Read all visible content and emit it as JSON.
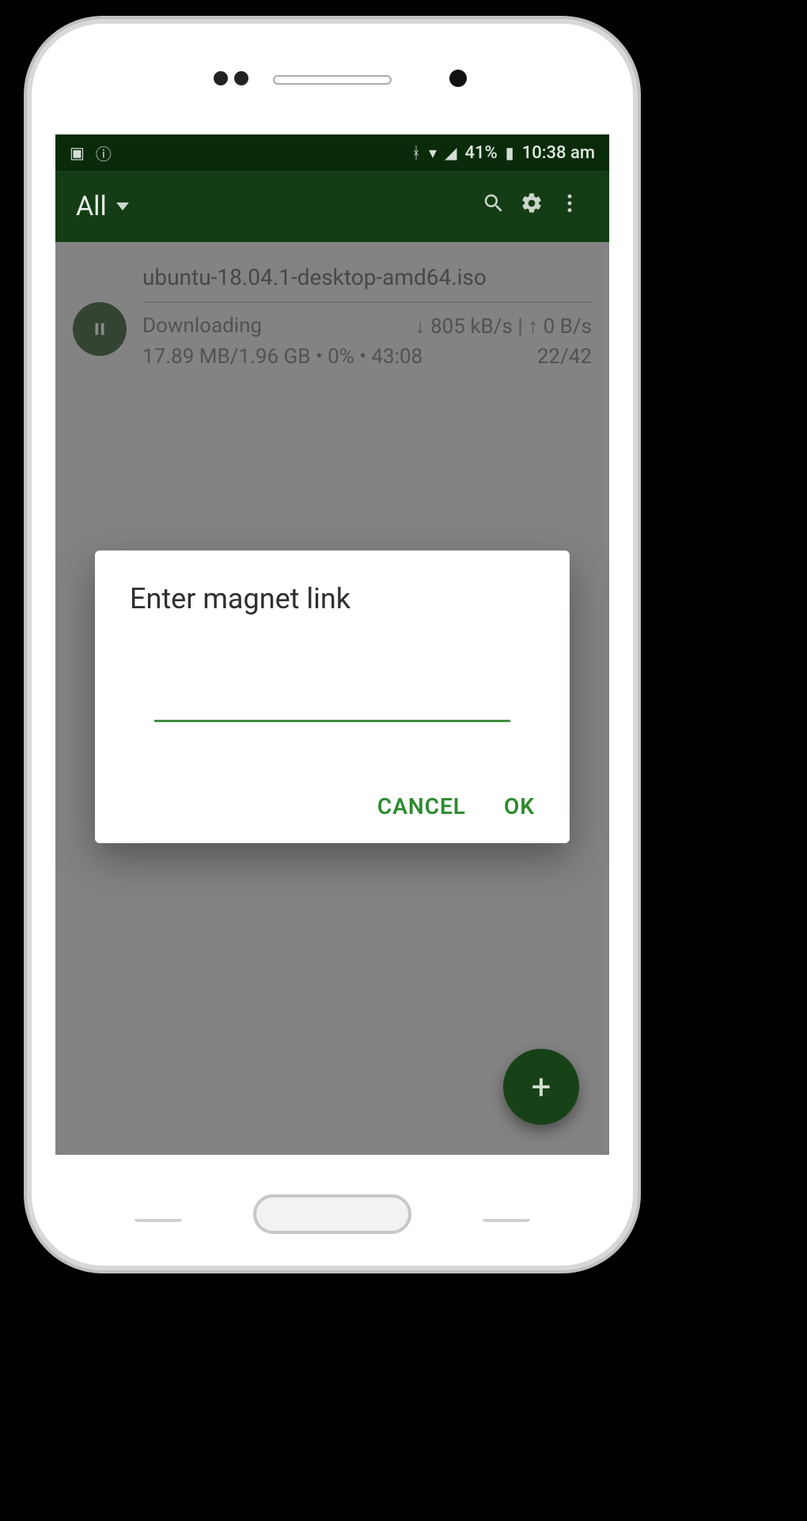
{
  "statusbar": {
    "left_icons": [
      "image-icon",
      "info-icon"
    ],
    "signal": "▮▮",
    "battery_text": "41%",
    "time": "10:38 am"
  },
  "appbar": {
    "filter_label": "All",
    "search_icon": "search-icon",
    "settings_icon": "gear-icon",
    "overflow_icon": "more-vert-icon"
  },
  "torrent": {
    "name": "ubuntu-18.04.1-desktop-amd64.iso",
    "status": "Downloading",
    "speeds": "↓ 805 kB/s | ↑ 0 B/s",
    "progress_line": "17.89 MB/1.96 GB • 0% • 43:08",
    "peers": "22/42"
  },
  "dialog": {
    "title": "Enter magnet link",
    "input_value": "",
    "cancel": "CANCEL",
    "ok": "OK"
  },
  "fab": {
    "label": "+"
  },
  "colors": {
    "primary_dark": "#153d15",
    "accent": "#2e8b2e"
  }
}
